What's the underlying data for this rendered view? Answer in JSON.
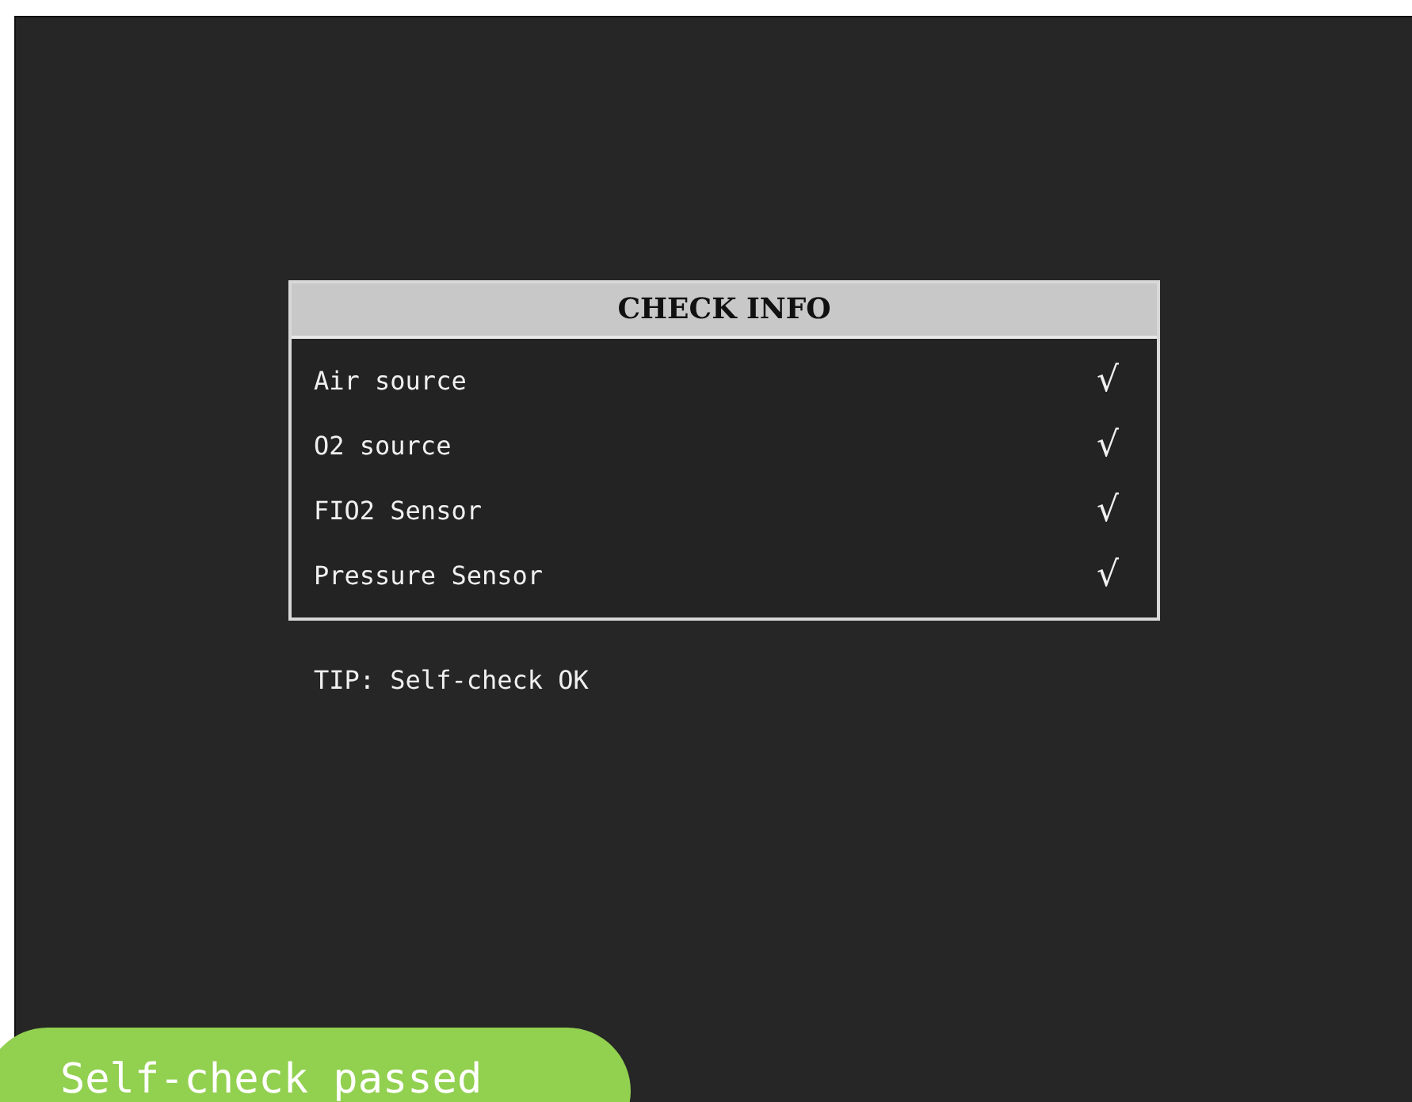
{
  "panel": {
    "title": "CHECK INFO",
    "items": [
      {
        "label": "Air source",
        "mark": "√",
        "checked": true
      },
      {
        "label": "O2 source",
        "mark": "√",
        "checked": true
      },
      {
        "label": "FIO2 Sensor",
        "mark": "√",
        "checked": true
      },
      {
        "label": "Pressure Sensor",
        "mark": "√",
        "checked": true
      }
    ]
  },
  "tip": "TIP: Self-check OK",
  "caption": "Self-check passed"
}
